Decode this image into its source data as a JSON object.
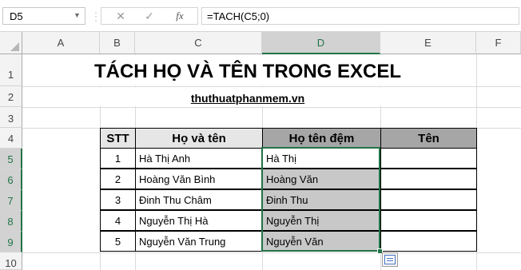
{
  "formula_bar": {
    "name_box": "D5",
    "cancel_icon": "✕",
    "enter_icon": "✓",
    "fx_label": "fx",
    "formula": "=TACH(C5;0)"
  },
  "columns": [
    "A",
    "B",
    "C",
    "D",
    "E",
    "F"
  ],
  "rows": [
    "1",
    "2",
    "3",
    "4",
    "5",
    "6",
    "7",
    "8",
    "9",
    "10"
  ],
  "sheet": {
    "title": "TÁCH HỌ VÀ TÊN TRONG EXCEL",
    "subtitle": "thuthuatphanmem.vn",
    "headers": {
      "stt": "STT",
      "full_name": "Họ và tên",
      "middle_name": "Họ tên đệm",
      "first_name": "Tên"
    },
    "rows": [
      {
        "stt": "1",
        "full_name": "Hà Thị Anh",
        "middle_name": "Hà Thị",
        "first_name": ""
      },
      {
        "stt": "2",
        "full_name": "Hoàng Văn Bình",
        "middle_name": "Hoàng Văn",
        "first_name": ""
      },
      {
        "stt": "3",
        "full_name": "Đinh Thu Châm",
        "middle_name": "Đinh Thu",
        "first_name": ""
      },
      {
        "stt": "4",
        "full_name": "Nguyễn Thị Hà",
        "middle_name": "Nguyễn Thị",
        "first_name": ""
      },
      {
        "stt": "5",
        "full_name": "Nguyễn Văn Trung",
        "middle_name": "Nguyễn Văn",
        "first_name": ""
      }
    ]
  },
  "colors": {
    "accent": "#217346",
    "header_fill": "#e6e6e6",
    "selected_fill": "#a6a6a6",
    "result_fill": "#c8c8c8"
  }
}
